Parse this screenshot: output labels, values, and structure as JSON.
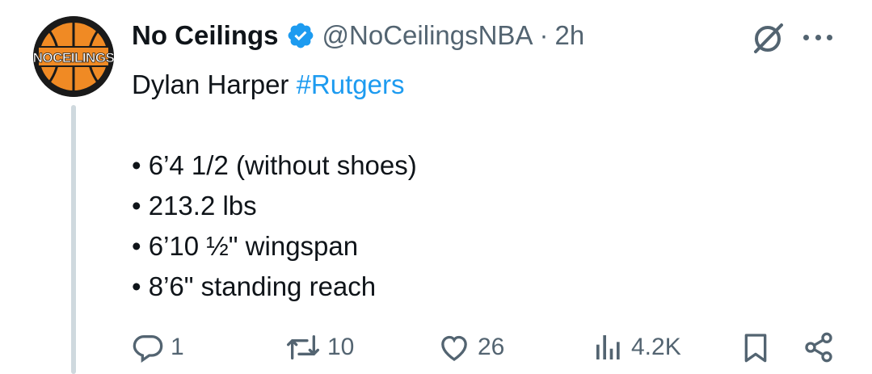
{
  "tweet": {
    "author": {
      "display_name": "No Ceilings",
      "handle": "@NoCeilingsNBA",
      "verified": true,
      "avatar_text": "NOCEILINGS",
      "avatar_colors": {
        "ring": "#1a1a1a",
        "ball": "#f08a24",
        "text": "#ffffff"
      }
    },
    "separator": "·",
    "time": "2h",
    "text": {
      "title_prefix": "Dylan Harper ",
      "hashtag": "#Rutgers",
      "bullets": [
        "• 6’4 1/2 (without shoes)",
        "• 213.2 lbs",
        "• 6’10 ½\" wingspan",
        "• 8’6\" standing reach"
      ]
    },
    "actions": {
      "replies": "1",
      "reposts": "10",
      "likes": "26",
      "views": "4.2K"
    },
    "colors": {
      "text_primary": "#0f1419",
      "text_secondary": "#536471",
      "accent": "#1d9bf0",
      "thread_line": "#cfd9de"
    },
    "icons": [
      "grok-icon",
      "more-options-icon",
      "reply-icon",
      "repost-icon",
      "like-icon",
      "views-icon",
      "bookmark-icon",
      "share-icon"
    ]
  }
}
